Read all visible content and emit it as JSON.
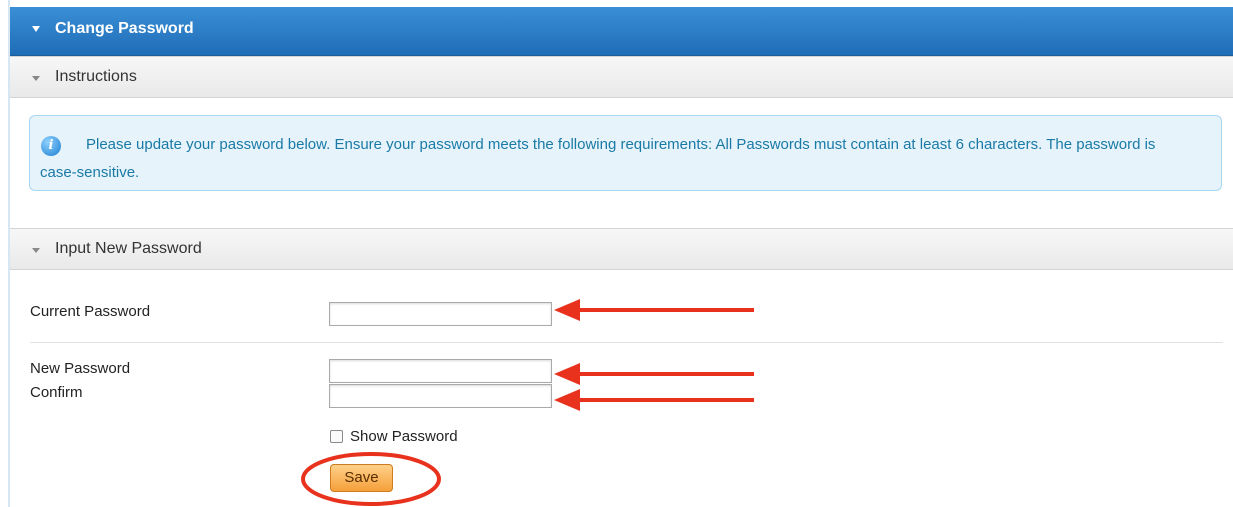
{
  "panel": {
    "title": "Change Password"
  },
  "sections": {
    "instructions": "Instructions",
    "input": "Input New Password"
  },
  "info": {
    "text": "Please update your password below. Ensure your password meets the following requirements: All Passwords must contain at least 6 characters. The password is case-sensitive."
  },
  "form": {
    "current_label": "Current Password",
    "current_value": "",
    "new_label": "New Password",
    "new_value": "",
    "confirm_label": "Confirm",
    "confirm_value": "",
    "show_password_label": "Show Password",
    "show_password_checked": false,
    "save_label": "Save"
  },
  "colors": {
    "title_bar": "#2a7dc9",
    "info_text": "#1a7aa6",
    "save_button": "#f5a03a",
    "annotation": "#e8321e"
  },
  "icons": {
    "info": "info-icon",
    "collapse": "collapse-triangle-icon"
  }
}
